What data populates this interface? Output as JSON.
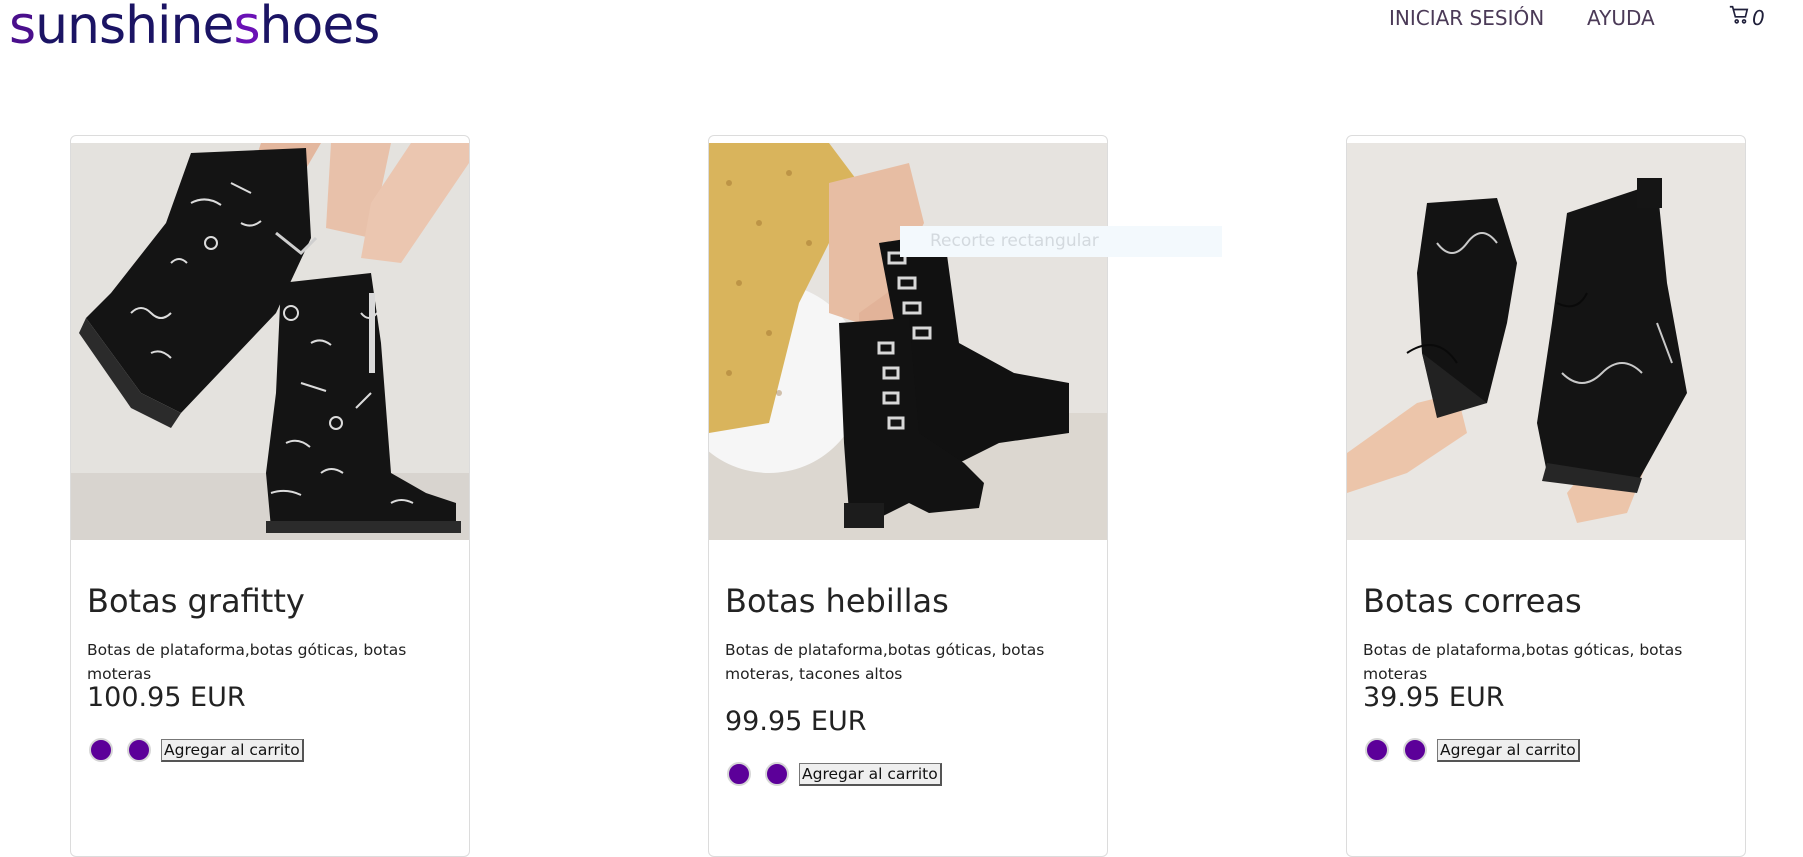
{
  "header": {
    "logo_s1": "s",
    "logo_part1": "unshine",
    "logo_s2": "s",
    "logo_part2": "hoes",
    "nav_login": "INICIAR SESIÓN",
    "nav_help": "AYUDA",
    "cart_count": "0",
    "cart_icon": "cart-icon"
  },
  "overlay": {
    "label": "Recorte rectangular"
  },
  "products": [
    {
      "title": "Botas grafitty",
      "description": "Botas de plataforma,botas góticas, botas moteras",
      "price": "100.95 EUR",
      "button": "Agregar al carrito",
      "image": "graffiti-boots-image"
    },
    {
      "title": "Botas hebillas",
      "description": "Botas de plataforma,botas góticas, botas moteras, tacones altos",
      "price": "99.95 EUR",
      "button": "Agregar al carrito",
      "image": "buckle-boots-image"
    },
    {
      "title": "Botas correas",
      "description": "Botas de plataforma,botas góticas, botas moteras",
      "price": "39.95 EUR",
      "button": "Agregar al carrito",
      "image": "strap-boots-image"
    }
  ],
  "colors": {
    "accent": "#5c0099",
    "logo": "#1b1464"
  }
}
